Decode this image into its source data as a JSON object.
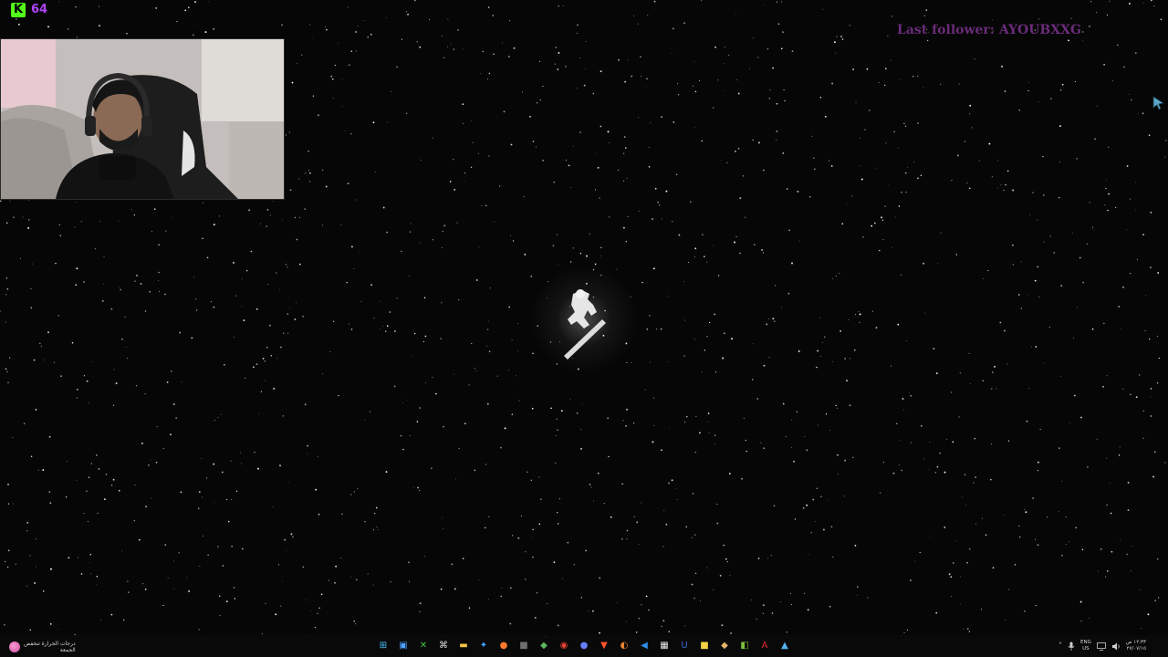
{
  "overlay": {
    "kick_logo_letter": "K",
    "viewer_count": "64",
    "last_follower_text": "Last follower: AYOUBXXG",
    "colors": {
      "kick_green": "#53fc18",
      "viewer_purple": "#b043ff",
      "follower_purple": "#6b2b7a"
    }
  },
  "desktop": {
    "wallpaper": "starfield with silver surfer",
    "icons": []
  },
  "taskbar": {
    "weather": {
      "icon": "weather-moon-icon",
      "line1": "درجات الحرارة تنخفض",
      "line2": "الجمعة"
    },
    "pinned": [
      {
        "name": "windows-start-icon",
        "glyph": "⊞",
        "color": "#4cc2ff"
      },
      {
        "name": "task-view-icon",
        "glyph": "▣",
        "color": "#4aa3ff"
      },
      {
        "name": "xbox-icon",
        "glyph": "✕",
        "color": "#3ec43e"
      },
      {
        "name": "obs-icon",
        "glyph": "⌘",
        "color": "#dcdcdc"
      },
      {
        "name": "file-explorer-icon",
        "glyph": "▬",
        "color": "#f5c542"
      },
      {
        "name": "copilot-icon",
        "glyph": "✦",
        "color": "#3fa3ff"
      },
      {
        "name": "firefox-icon",
        "glyph": "●",
        "color": "#ff7a2e"
      },
      {
        "name": "app-icon",
        "glyph": "■",
        "color": "#6f6f6f"
      },
      {
        "name": "minecraft-icon",
        "glyph": "◆",
        "color": "#5db85d"
      },
      {
        "name": "chrome-icon",
        "glyph": "◉",
        "color": "#e94335"
      },
      {
        "name": "discord-icon",
        "glyph": "●",
        "color": "#6a7cff"
      },
      {
        "name": "brave-icon",
        "glyph": "▼",
        "color": "#fb542b"
      },
      {
        "name": "blender-icon",
        "glyph": "◐",
        "color": "#f0832b"
      },
      {
        "name": "vscode-icon",
        "glyph": "◀",
        "color": "#2f8fe6"
      },
      {
        "name": "calculator-icon",
        "glyph": "▦",
        "color": "#e8e8e8"
      },
      {
        "name": "bitwarden-icon",
        "glyph": "U",
        "color": "#3f6fd6"
      },
      {
        "name": "notes-icon",
        "glyph": "■",
        "color": "#f5d442"
      },
      {
        "name": "sandwich-icon",
        "glyph": "◆",
        "color": "#e5b36a"
      },
      {
        "name": "minecraft-launcher-icon",
        "glyph": "◧",
        "color": "#7cbf3c"
      },
      {
        "name": "acrobat-icon",
        "glyph": "A",
        "color": "#e0282e"
      },
      {
        "name": "photos-icon",
        "glyph": "▲",
        "color": "#56b3f0"
      }
    ],
    "tray": {
      "chevron": "˄",
      "mic_icon": "🎙",
      "lang_line1": "ENG",
      "lang_line2": "US",
      "time": "١٢:٣٣ ص",
      "date": "٢٧/٠٧/١٥"
    }
  }
}
